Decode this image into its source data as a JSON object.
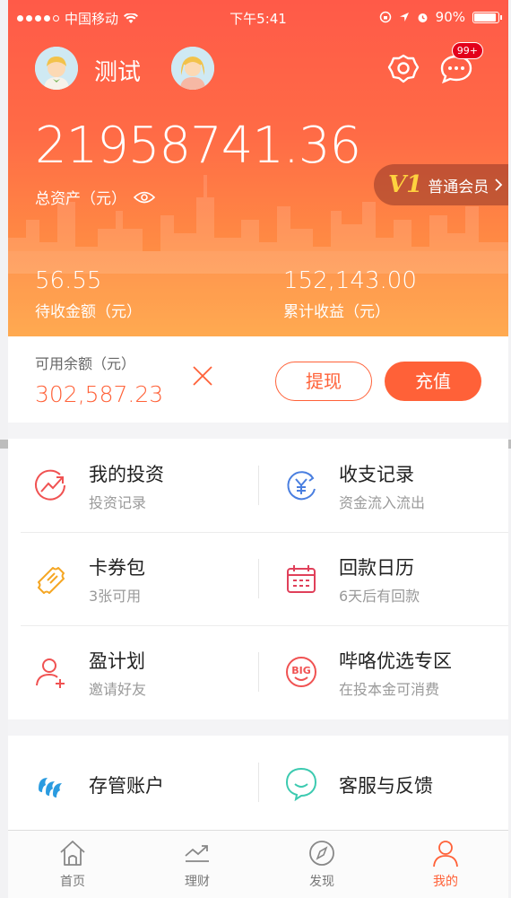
{
  "status_bar": {
    "carrier": "中国移动",
    "time": "下午5:41",
    "battery": "90%"
  },
  "header": {
    "username": "测试",
    "message_badge": "99+",
    "total_assets": "21958741.36",
    "total_assets_label": "总资产（元）",
    "vip_level": "V1",
    "vip_label": "普通会员",
    "pending_amount": "56.55",
    "pending_label": "待收金额（元）",
    "cumulative_amount": "152,143.00",
    "cumulative_label": "累计收益（元）"
  },
  "balance": {
    "label": "可用余额（元）",
    "value": "302,587.23",
    "withdraw_label": "提现",
    "recharge_label": "充值"
  },
  "menu": [
    {
      "title": "我的投资",
      "subtitle": "投资记录",
      "icon": "investment-chart-icon"
    },
    {
      "title": "收支记录",
      "subtitle": "资金流入流出",
      "icon": "yuan-cycle-icon"
    },
    {
      "title": "卡券包",
      "subtitle": "3张可用",
      "icon": "ticket-icon"
    },
    {
      "title": "回款日历",
      "subtitle": "6天后有回款",
      "icon": "calendar-icon"
    },
    {
      "title": "盈计划",
      "subtitle": "邀请好友",
      "icon": "add-user-icon"
    },
    {
      "title": "哔咯优选专区",
      "subtitle": "在投本金可消费",
      "icon": "big-smile-icon"
    }
  ],
  "menu2": [
    {
      "title": "存管账户",
      "icon": "bank-logo-icon"
    },
    {
      "title": "客服与反馈",
      "icon": "chat-bubble-icon"
    }
  ],
  "tabs": [
    {
      "label": "首页",
      "icon": "home-icon"
    },
    {
      "label": "理财",
      "icon": "trend-icon"
    },
    {
      "label": "发现",
      "icon": "compass-icon"
    },
    {
      "label": "我的",
      "icon": "user-icon"
    }
  ],
  "colors": {
    "accent": "#ff6138",
    "header_top": "#ff5a48",
    "header_bottom": "#ffa546"
  }
}
